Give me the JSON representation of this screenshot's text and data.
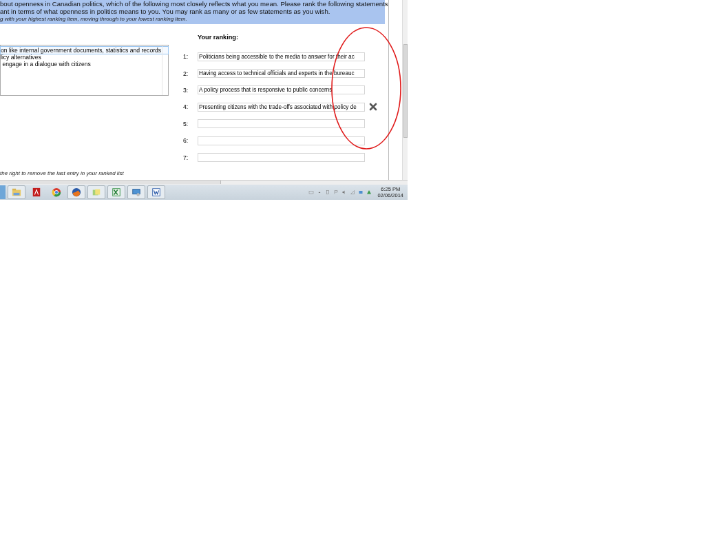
{
  "question": {
    "lines": [
      "bout openness in Canadian politics, which of the following most closely reflects what you mean.  Please rank the following statements",
      "ant in terms of what openness in politics means to you. You may rank as many or as few statements as you wish."
    ],
    "instruction": "g with your highest ranking item, moving through to your lowest ranking item."
  },
  "options": {
    "items": [
      {
        "text": "on like internal government documents, statistics and records",
        "selected": true
      },
      {
        "text": "licy alternatives",
        "selected": false
      },
      {
        "text": " engage in a dialogue with citizens",
        "selected": false
      }
    ]
  },
  "ranking": {
    "heading": "Your ranking:",
    "slots": [
      {
        "number": "1:",
        "value": "Politicians being accessible to the media to answer for their ac"
      },
      {
        "number": "2:",
        "value": "Having access to technical officials and experts in the bureauc"
      },
      {
        "number": "3:",
        "value": "A policy process that is responsive to public concerns"
      },
      {
        "number": "4:",
        "value": "Presenting citizens with the trade-offs associated with policy de",
        "removable": true
      },
      {
        "number": "5:"
      },
      {
        "number": "6:"
      },
      {
        "number": "7:"
      }
    ]
  },
  "remove_hint": "the right to remove the last entry in your ranked list",
  "taskbar": {
    "apps": [
      {
        "kind": "folder",
        "running": true
      },
      {
        "kind": "pdf",
        "running": false
      },
      {
        "kind": "globe",
        "running": false
      },
      {
        "kind": "fox",
        "running": true
      },
      {
        "kind": "files",
        "running": true
      },
      {
        "kind": "sheet",
        "running": true
      },
      {
        "kind": "monitor",
        "running": true
      },
      {
        "kind": "doc",
        "running": true
      }
    ],
    "clock": {
      "time": "6:25 PM",
      "date": "02/06/2014"
    }
  }
}
